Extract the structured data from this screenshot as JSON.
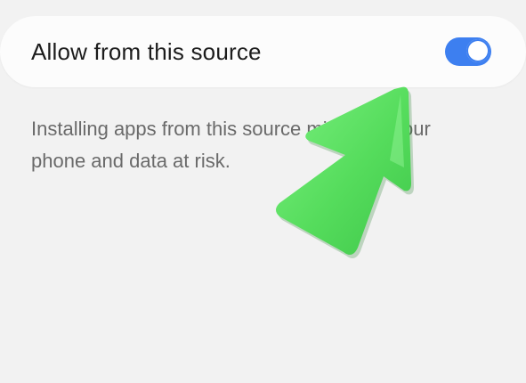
{
  "setting": {
    "label": "Allow from this source",
    "toggle_state": "on",
    "toggle_color": "#3d7ff0"
  },
  "description": {
    "text": "Installing apps from this source might put your phone and data at risk."
  },
  "overlay": {
    "icon": "arrow-pointer-icon",
    "color": "#5ee065"
  }
}
